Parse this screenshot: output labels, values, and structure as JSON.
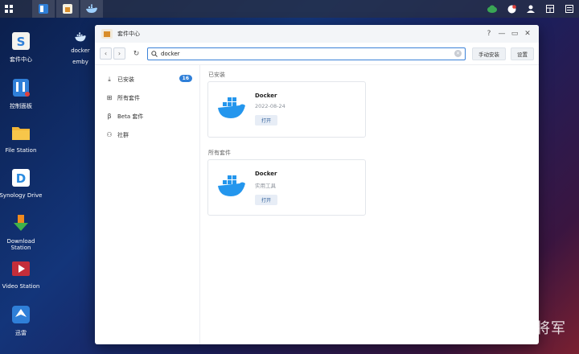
{
  "taskbar": {
    "apps": [
      "main-menu",
      "file-manager",
      "package-center",
      "docker"
    ]
  },
  "desktop": {
    "icons": [
      {
        "label": "套件中心"
      },
      {
        "label": "docker"
      },
      {
        "label": "emby"
      },
      {
        "label": "控制面板"
      },
      {
        "label": "File Station"
      },
      {
        "label": "Synology Drive"
      },
      {
        "label": "Download Station"
      },
      {
        "label": "Video Station"
      },
      {
        "label": "迅雷"
      }
    ]
  },
  "window": {
    "title": "套件中心",
    "controls": {
      "help": "?",
      "minimize": "—",
      "maximize": "▭",
      "close": "✕"
    }
  },
  "toolbar": {
    "search_value": "docker",
    "manual_install_label": "手动安装",
    "settings_label": "设置"
  },
  "sidebar": {
    "items": [
      {
        "label": "已安装",
        "badge": "16",
        "icon": "download-icon"
      },
      {
        "label": "所有套件",
        "icon": "grid-icon"
      },
      {
        "label": "Beta 套件",
        "icon": "beta-icon"
      },
      {
        "label": "社群",
        "icon": "community-icon"
      }
    ]
  },
  "main": {
    "installed_label": "已安装",
    "all_label": "所有套件",
    "installed_pkg": {
      "name": "Docker",
      "sub": "2022-08-24",
      "button": "打开"
    },
    "all_pkg": {
      "name": "Docker",
      "sub": "实用工具",
      "button": "打开"
    }
  },
  "watermark": "知乎 @检校千牛卫大将军",
  "colors": {
    "accent": "#2f7fd8",
    "docker_blue": "#2496ed"
  }
}
